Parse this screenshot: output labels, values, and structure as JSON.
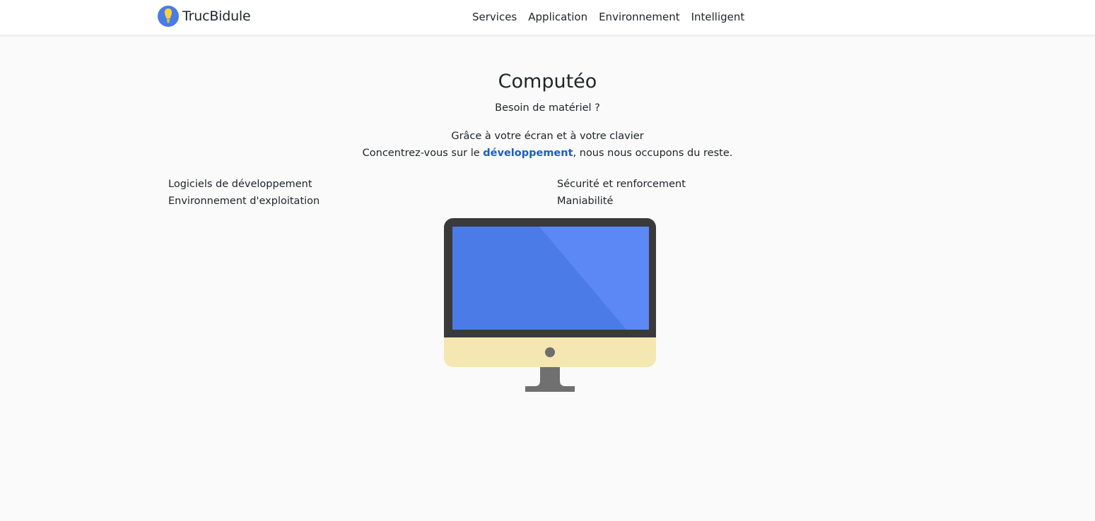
{
  "header": {
    "brand": "TrucBidule",
    "nav": [
      {
        "label": "Services"
      },
      {
        "label": "Application"
      },
      {
        "label": "Environnement"
      },
      {
        "label": "Intelligent"
      }
    ]
  },
  "hero": {
    "title": "Computéo",
    "subtitle": "Besoin de matériel ?",
    "line1": "Grâce à votre écran et à votre clavier",
    "line2_before": "Concentrez-vous sur le ",
    "line2_highlight": "développement",
    "line2_after": ", nous nous occupons du reste."
  },
  "features": {
    "left": [
      "Logiciels de développement",
      "Environnement d'exploitation"
    ],
    "right": [
      "Sécurité et renforcement",
      "Maniabilité"
    ]
  },
  "colors": {
    "screen_blue": "#4a7be6",
    "screen_glare": "#5b88f5",
    "monitor_frame": "#3a3a3a",
    "chin": "#f4e7b2",
    "stand": "#707070",
    "highlight": "#1a5fc0",
    "logo_blue": "#4a7be6",
    "logo_yellow": "#f2d43a"
  },
  "icons": {
    "brand": "lightbulb-logo-icon",
    "monitor": "desktop-monitor-illustration"
  }
}
